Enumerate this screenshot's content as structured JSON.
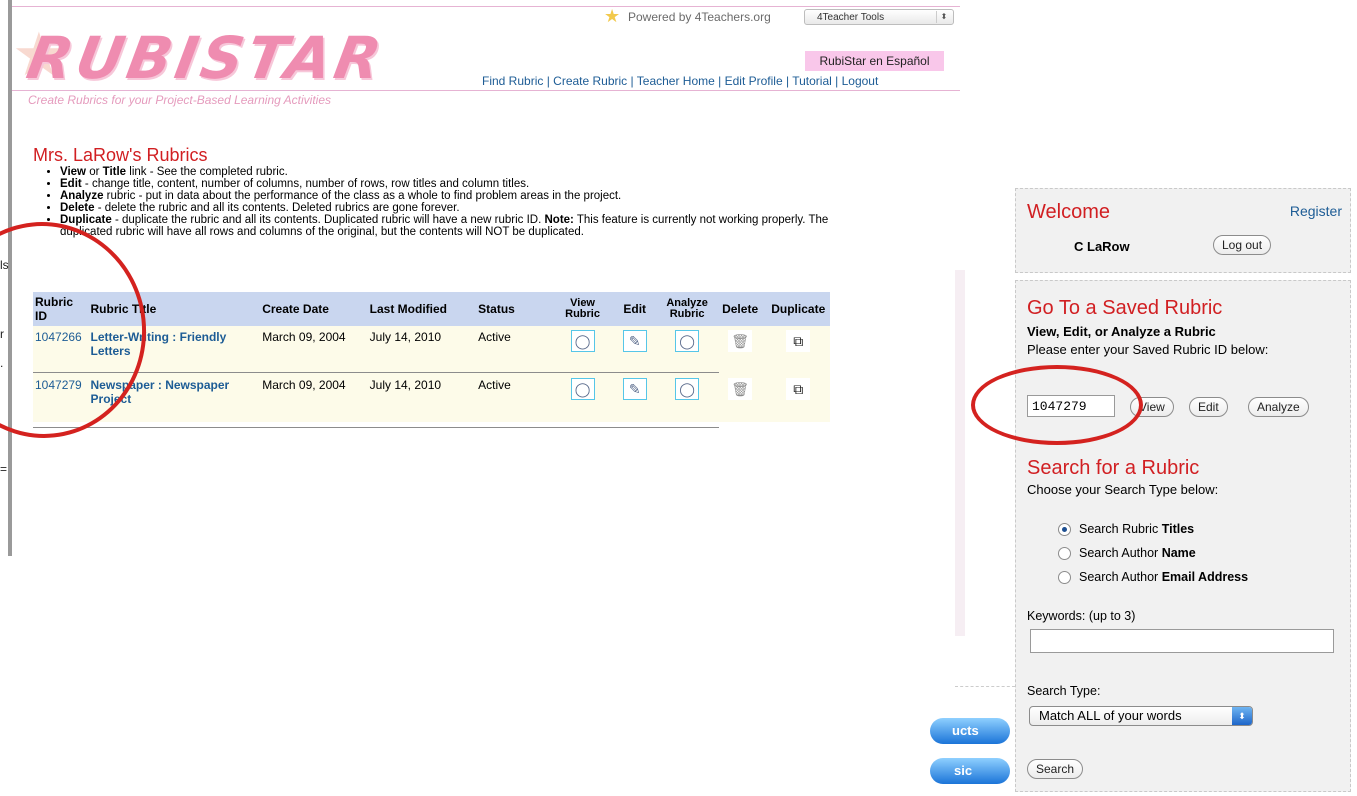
{
  "header": {
    "powered_by": "Powered by 4Teachers.org",
    "tools_select_value": "4Teacher Tools",
    "logo_text": "RUBISTAR",
    "tagline": "Create Rubrics for your Project-Based Learning Activities",
    "espanol_link": "RubiStar en Español",
    "nav": [
      "Find Rubric",
      "Create Rubric",
      "Teacher Home",
      "Edit Profile",
      "Tutorial",
      "Logout"
    ]
  },
  "page": {
    "title": "Mrs. LaRow's Rubrics",
    "bullets": [
      {
        "bold": "View",
        "mid": " or ",
        "bold2": "Title",
        "text": " link - See the completed rubric."
      },
      {
        "bold": "Edit",
        "text": " - change title, content, number of columns, number of rows, row titles and column titles."
      },
      {
        "bold": "Analyze",
        "text": " rubric - put in data about the performance of the class as a whole to find problem areas in the project."
      },
      {
        "bold": "Delete",
        "text": " - delete the rubric and all its contents. Deleted rubrics are gone forever."
      },
      {
        "bold": "Duplicate",
        "text": " - duplicate the rubric and all its contents. Duplicated rubric will have a new rubric ID. ",
        "bold2": "Note:",
        "text2": " This feature is currently not working properly. The duplicated rubric will have all rows and columns of the original, but the contents will NOT be duplicated."
      }
    ]
  },
  "table": {
    "headers": {
      "id": "Rubric ID",
      "title": "Rubric Title",
      "created": "Create Date",
      "modified": "Last Modified",
      "status": "Status",
      "view": "View Rubric",
      "edit": "Edit",
      "analyze": "Analyze Rubric",
      "delete": "Delete",
      "duplicate": "Duplicate"
    },
    "rows": [
      {
        "id": "1047266",
        "title": "Letter-Writing : Friendly Letters",
        "created": "March 09, 2004",
        "modified": "July 14, 2010",
        "status": "Active"
      },
      {
        "id": "1047279",
        "title": "Newspaper : Newspaper Project",
        "created": "March 09, 2004",
        "modified": "July 14, 2010",
        "status": "Active"
      }
    ]
  },
  "sidebar": {
    "welcome": "Welcome",
    "register": "Register",
    "user": "C LaRow",
    "logout": "Log out",
    "saved_title": "Go To a Saved Rubric",
    "saved_subtitle": "View, Edit, or Analyze a Rubric",
    "saved_prompt": "Please enter your Saved Rubric ID below:",
    "rubric_id_value": "1047279",
    "btn_view": "View",
    "btn_edit": "Edit",
    "btn_analyze": "Analyze",
    "search_title": "Search for a Rubric",
    "search_prompt": "Choose your Search Type below:",
    "radio_options": [
      {
        "prefix": "Search Rubric ",
        "bold": "Titles",
        "checked": true
      },
      {
        "prefix": "Search Author ",
        "bold": "Name",
        "checked": false
      },
      {
        "prefix": "Search Author ",
        "bold": "Email Address",
        "checked": false
      }
    ],
    "keywords_label": "Keywords: (up to 3)",
    "keywords_value": "",
    "search_type_label": "Search Type:",
    "search_type_value": "Match ALL of your words",
    "search_button": "Search"
  },
  "background": {
    "edge_chars": [
      "ls",
      "r",
      "=",
      "."
    ],
    "pill_buttons": [
      "ucts",
      "sic"
    ]
  },
  "colors": {
    "accent_red": "#d11f22",
    "link_blue": "#1d5c95",
    "logo_pink": "#ef8cb0",
    "table_header_bg": "#c9d6ef"
  }
}
